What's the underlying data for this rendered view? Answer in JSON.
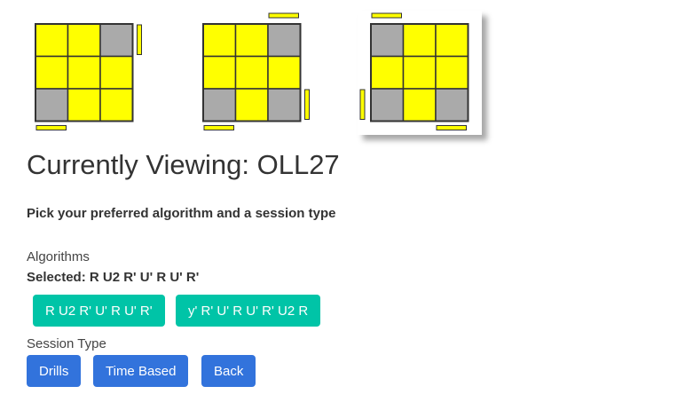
{
  "colors": {
    "yellow": "#ffff00",
    "gray": "#aaaaaa",
    "outline": "#333333",
    "teal": "#00c4a7",
    "blue": "#3273dc"
  },
  "cases": [
    {
      "grid": [
        "Y",
        "Y",
        "G",
        "Y",
        "Y",
        "Y",
        "G",
        "Y",
        "Y"
      ],
      "sides": {
        "top": [
          0,
          0,
          0
        ],
        "right": [
          1,
          0,
          0
        ],
        "bottom": [
          1,
          0,
          0
        ],
        "left": [
          0,
          0,
          0
        ]
      },
      "selected": false
    },
    {
      "grid": [
        "Y",
        "Y",
        "G",
        "Y",
        "Y",
        "Y",
        "G",
        "Y",
        "G"
      ],
      "sides": {
        "top": [
          0,
          0,
          1
        ],
        "right": [
          0,
          0,
          1
        ],
        "bottom": [
          1,
          0,
          0
        ],
        "left": [
          0,
          0,
          0
        ]
      },
      "selected": false
    },
    {
      "grid": [
        "G",
        "Y",
        "Y",
        "Y",
        "Y",
        "Y",
        "G",
        "Y",
        "G"
      ],
      "sides": {
        "top": [
          1,
          0,
          0
        ],
        "right": [
          0,
          0,
          0
        ],
        "bottom": [
          0,
          0,
          1
        ],
        "left": [
          0,
          0,
          1
        ]
      },
      "selected": true
    }
  ],
  "main": {
    "title": "Currently Viewing: OLL27",
    "subtitle": "Pick your preferred algorithm and a session type"
  },
  "algorithms": {
    "label": "Algorithms",
    "selected_text": "Selected: R U2 R' U' R U' R'",
    "options": [
      "R U2 R' U' R U' R'",
      "y' R' U' R U' R' U2 R"
    ]
  },
  "session": {
    "label": "Session Type",
    "buttons": [
      "Drills",
      "Time Based",
      "Back"
    ]
  }
}
